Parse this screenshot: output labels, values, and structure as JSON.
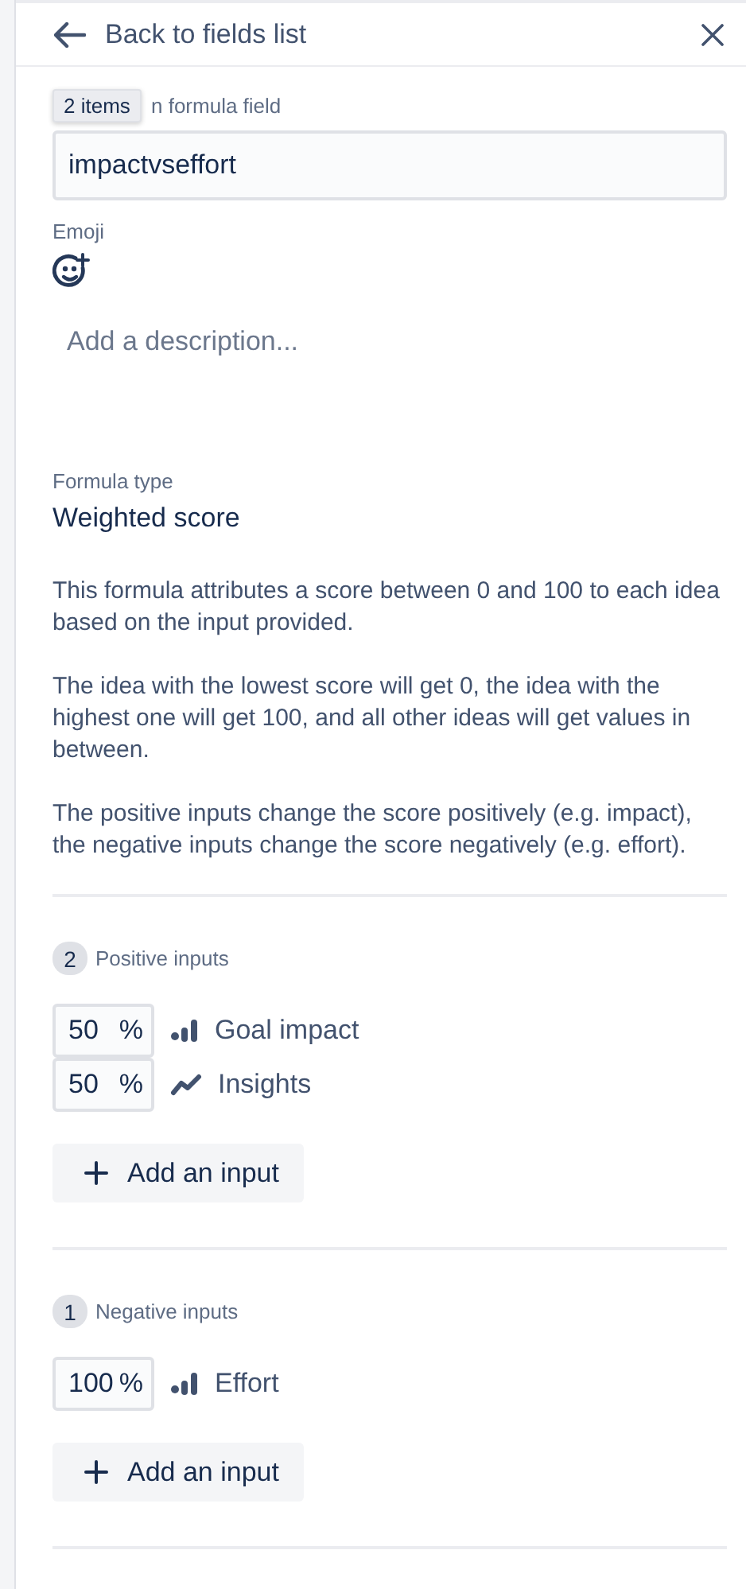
{
  "header": {
    "back_label": "Back to fields list"
  },
  "name_field": {
    "label": "n formula field",
    "tooltip": "2 items",
    "value": "impactvseffort"
  },
  "emoji": {
    "label": "Emoji"
  },
  "description": {
    "placeholder": "Add a description..."
  },
  "formula_type": {
    "label": "Formula type",
    "value": "Weighted score"
  },
  "explanation": [
    "This formula attributes a score between 0 and 100 to each idea based on the input provided.",
    "The idea with the lowest score will get 0, the idea with the highest one will get 100, and all other ideas will get values in between.",
    "The positive inputs change the score positively (e.g. impact), the negative inputs change the score negatively (e.g. effort)."
  ],
  "sections": [
    {
      "count": "2",
      "title": "Positive inputs",
      "inputs": [
        {
          "weight": "50",
          "unit": "%",
          "kind": "bars",
          "name": "Goal impact"
        },
        {
          "weight": "50",
          "unit": "%",
          "kind": "trend",
          "name": "Insights"
        }
      ],
      "add_button": "Add an input"
    },
    {
      "count": "1",
      "title": "Negative inputs",
      "inputs": [
        {
          "weight": "100",
          "unit": "%",
          "kind": "bars",
          "name": "Effort"
        }
      ],
      "add_button": "Add an input"
    }
  ]
}
